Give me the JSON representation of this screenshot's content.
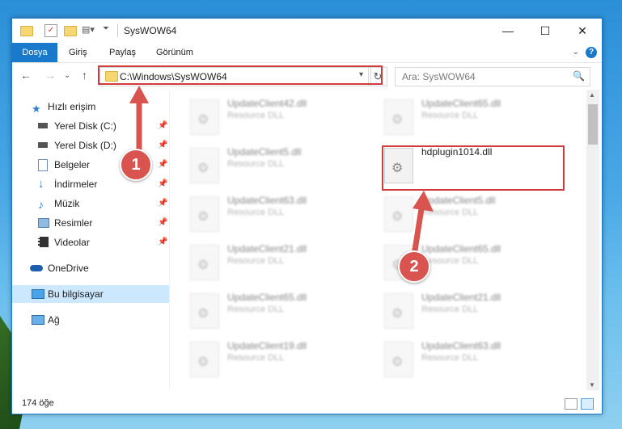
{
  "window": {
    "title": "SysWOW64",
    "controls": {
      "minimize": "—",
      "maximize": "☐",
      "close": "✕"
    }
  },
  "ribbon": {
    "tabs": [
      "Dosya",
      "Giriş",
      "Paylaş",
      "Görünüm"
    ],
    "active_tab": "Dosya",
    "help": "?"
  },
  "navigation": {
    "back": "←",
    "forward": "→",
    "recent": "⌄",
    "up": "↑",
    "address": "C:\\Windows\\SysWOW64",
    "refresh": "↻",
    "search_placeholder": "Ara: SysWOW64"
  },
  "sidebar": {
    "items": [
      {
        "label": "Hızlı erişim",
        "icon": "star-icon"
      },
      {
        "label": "Yerel Disk (C:)",
        "icon": "drive-icon",
        "pinned": true
      },
      {
        "label": "Yerel Disk (D:)",
        "icon": "drive-icon",
        "pinned": true
      },
      {
        "label": "Belgeler",
        "icon": "documents-icon",
        "pinned": true
      },
      {
        "label": "İndirmeler",
        "icon": "download-icon",
        "pinned": true
      },
      {
        "label": "Müzik",
        "icon": "music-icon",
        "pinned": true
      },
      {
        "label": "Resimler",
        "icon": "pictures-icon",
        "pinned": true
      },
      {
        "label": "Videolar",
        "icon": "video-icon",
        "pinned": true
      },
      {
        "label": "OneDrive",
        "icon": "cloud-icon"
      },
      {
        "label": "Bu bilgisayar",
        "icon": "computer-icon",
        "selected": true
      },
      {
        "label": "Ağ",
        "icon": "network-icon"
      }
    ],
    "pin_glyph": "📌"
  },
  "files": {
    "type_label": "Resource DLL",
    "left_column": [
      "UpdateClient42.dll",
      "UpdateClient5.dll",
      "UpdateClient63.dll",
      "UpdateClient21.dll",
      "UpdateClient65.dll",
      "UpdateClient19.dll"
    ],
    "right_column": [
      "UpdateClient65.dll",
      "hdplugin1014.dll",
      "UpdateClient5.dll",
      "UpdateClient65.dll",
      "UpdateClient21.dll",
      "UpdateClient63.dll"
    ],
    "highlighted": "hdplugin1014.dll"
  },
  "status": {
    "count": "174 öğe"
  },
  "annotations": {
    "step1": "1",
    "step2": "2"
  },
  "colors": {
    "accent": "#1979ca",
    "highlight": "#d23b3b",
    "badge": "#d9534f"
  }
}
